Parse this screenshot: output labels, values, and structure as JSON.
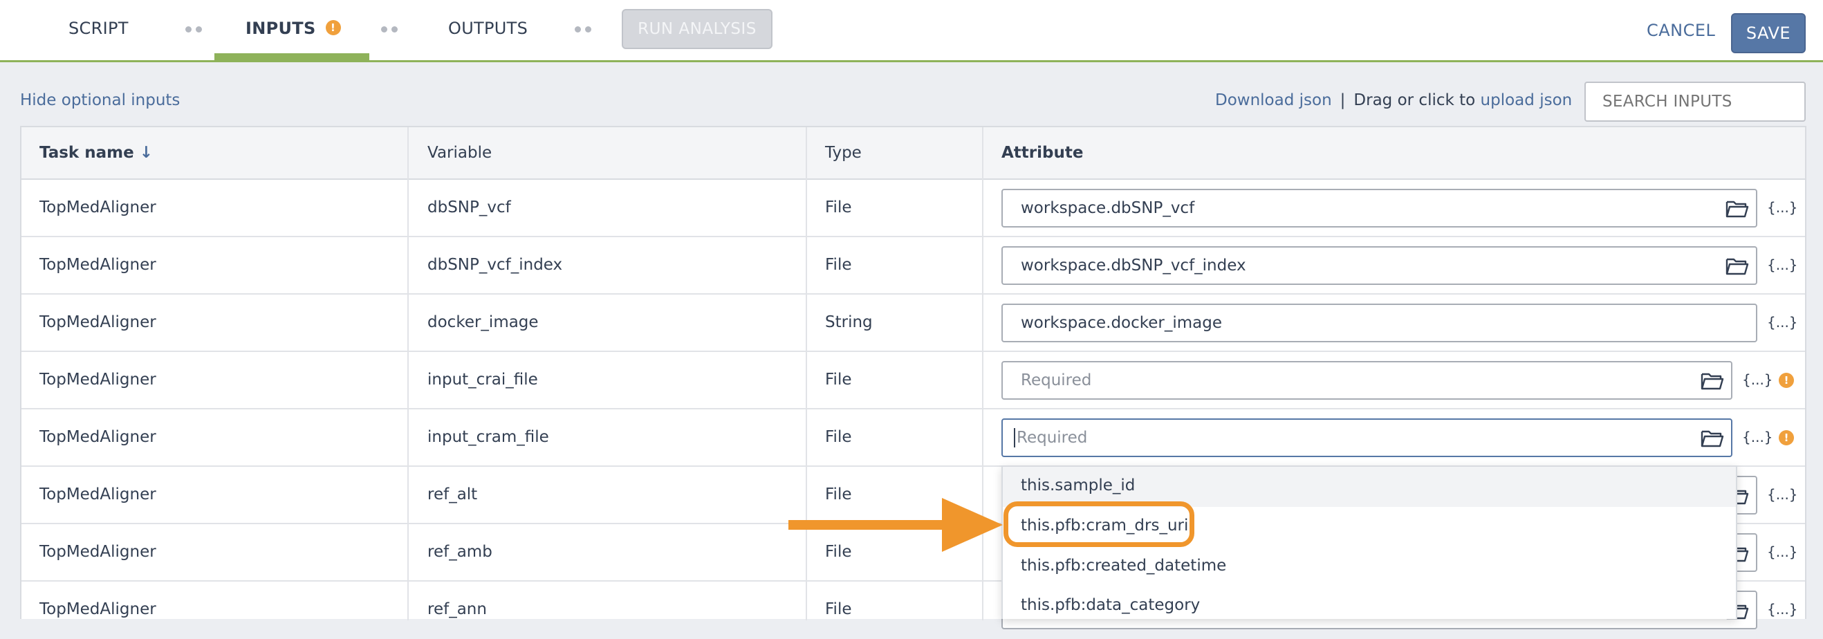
{
  "header": {
    "tabs": [
      {
        "label": "SCRIPT"
      },
      {
        "label": "INPUTS"
      },
      {
        "label": "OUTPUTS"
      }
    ],
    "inputs_warning": "!",
    "run_label": "RUN ANALYSIS",
    "cancel_label": "CANCEL",
    "save_label": "SAVE"
  },
  "actions": {
    "hide_optional": "Hide optional inputs",
    "download_json": "Download json",
    "separator": "|",
    "upload_prefix": "Drag or click to",
    "upload_link": "upload json",
    "search_placeholder": "SEARCH INPUTS"
  },
  "table": {
    "headers": {
      "task": "Task name",
      "sort_icon": "↓",
      "variable": "Variable",
      "type": "Type",
      "attribute": "Attribute"
    },
    "expr_label": "{...}",
    "warn_glyph": "!",
    "rows": [
      {
        "task": "TopMedAligner",
        "variable": "dbSNP_vcf",
        "type": "File",
        "attribute": "workspace.dbSNP_vcf"
      },
      {
        "task": "TopMedAligner",
        "variable": "dbSNP_vcf_index",
        "type": "File",
        "attribute": "workspace.dbSNP_vcf_index"
      },
      {
        "task": "TopMedAligner",
        "variable": "docker_image",
        "type": "String",
        "attribute": "workspace.docker_image"
      },
      {
        "task": "TopMedAligner",
        "variable": "input_crai_file",
        "type": "File",
        "placeholder": "Required"
      },
      {
        "task": "TopMedAligner",
        "variable": "input_cram_file",
        "type": "File",
        "placeholder": "Required"
      },
      {
        "task": "TopMedAligner",
        "variable": "ref_alt",
        "type": "File"
      },
      {
        "task": "TopMedAligner",
        "variable": "ref_amb",
        "type": "File"
      },
      {
        "task": "TopMedAligner",
        "variable": "ref_ann",
        "type": "File"
      }
    ]
  },
  "dropdown": {
    "options": [
      "this.sample_id",
      "this.pfb:cram_drs_uri",
      "this.pfb:created_datetime",
      "this.pfb:data_category"
    ],
    "highlighted_color": "#f0962c"
  },
  "colors": {
    "accent_green": "#8eb25a",
    "link_blue": "#4a6c9b",
    "save_blue": "#5677a6",
    "warning_orange": "#f0a03c"
  }
}
